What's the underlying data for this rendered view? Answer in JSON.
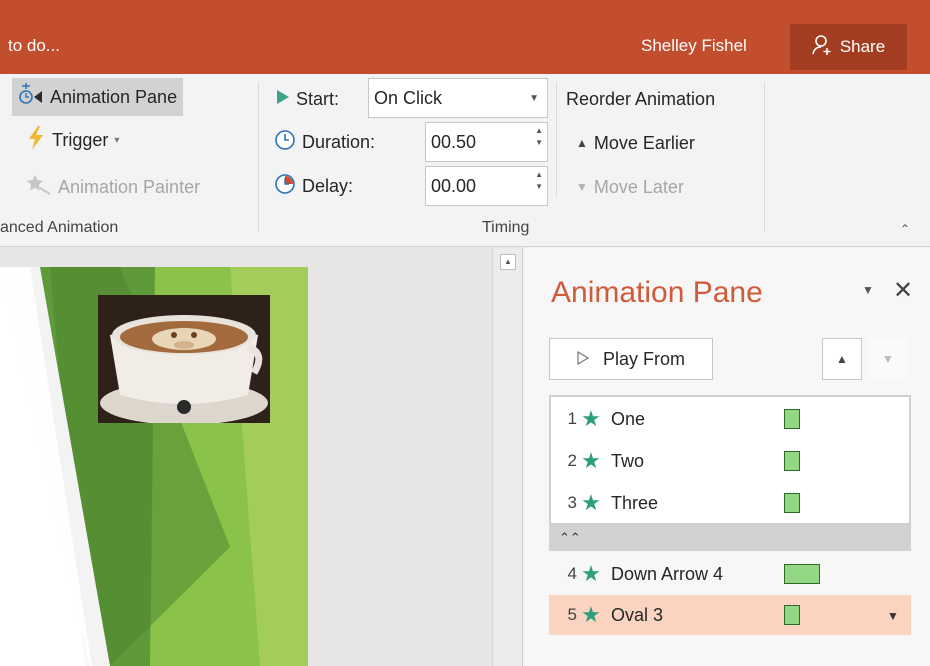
{
  "titlebar": {
    "tell_me": "to do...",
    "user": "Shelley Fishel",
    "share_label": "Share"
  },
  "ribbon": {
    "advanced_animation": {
      "group_label": "anced Animation",
      "animation_pane": "Animation Pane",
      "trigger": "Trigger",
      "animation_painter": "Animation Painter"
    },
    "timing": {
      "group_label": "Timing",
      "start_label": "Start:",
      "start_value": "On Click",
      "duration_label": "Duration:",
      "duration_value": "00.50",
      "delay_label": "Delay:",
      "delay_value": "00.00",
      "reorder_label": "Reorder Animation",
      "move_earlier": "Move Earlier",
      "move_later": "Move Later"
    }
  },
  "pane": {
    "title": "Animation Pane",
    "play_from": "Play From",
    "items": [
      {
        "num": "1",
        "label": "One"
      },
      {
        "num": "2",
        "label": "Two"
      },
      {
        "num": "3",
        "label": "Three"
      },
      {
        "num": "4",
        "label": "Down Arrow 4"
      },
      {
        "num": "5",
        "label": "Oval 3"
      }
    ]
  },
  "colors": {
    "titlebar": "#c24e2e",
    "pane_title": "#d15a3a",
    "star": "#2e9e7c",
    "timeline_bar": "#93d684",
    "selected_row": "#fad4c0"
  }
}
